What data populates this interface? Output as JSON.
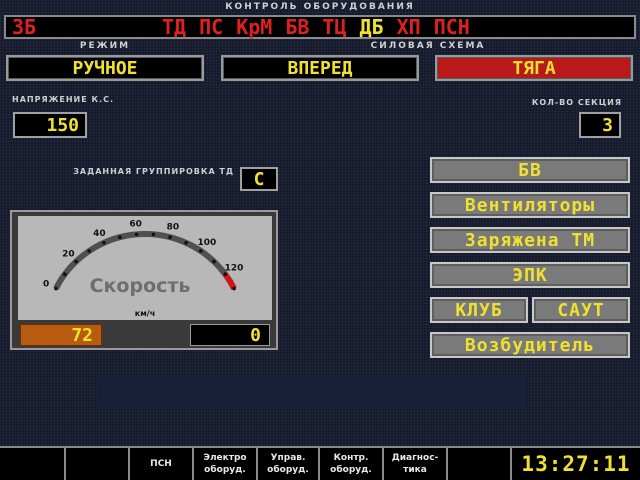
{
  "header": {
    "title": "КОНТРОЛЬ ОБОРУДОВАНИЯ",
    "code": "3Б",
    "indicators": [
      {
        "label": "ТД",
        "color": "#e02020"
      },
      {
        "label": "ПС",
        "color": "#e02020"
      },
      {
        "label": "КрМ",
        "color": "#e02020"
      },
      {
        "label": "БВ",
        "color": "#e02020"
      },
      {
        "label": "ТЦ",
        "color": "#e02020"
      },
      {
        "label": "ДБ",
        "color": "#f0e030"
      },
      {
        "label": "ХП",
        "color": "#e02020"
      },
      {
        "label": "ПСН",
        "color": "#e02020"
      }
    ]
  },
  "mode": {
    "label": "РЕЖИМ",
    "value": "РУЧНОЕ"
  },
  "power_scheme": {
    "label": "СИЛОВАЯ СХЕМА",
    "direction": "ВПЕРЕД",
    "state": "ТЯГА",
    "state_color": "#b81a1a"
  },
  "voltage": {
    "label": "НАПРЯЖЕНИЕ К.С.",
    "value": "150"
  },
  "sections": {
    "label": "КОЛ-ВО СЕКЦИЯ",
    "value": "3"
  },
  "grouping": {
    "label": "ЗАДАННАЯ ГРУППИРОВКА ТД",
    "value": "С"
  },
  "side_buttons": {
    "bv": "БВ",
    "fans": "Вентиляторы",
    "charged": "Заряжена ТМ",
    "epk": "ЭПК",
    "klub": "КЛУБ",
    "saut": "САУТ",
    "exciter": "Возбудитель"
  },
  "speedometer": {
    "title": "Скорость",
    "unit": "км/ч",
    "scale_min": 0,
    "scale_max": 130,
    "red_zone_from": 120,
    "tick_labels": [
      "0",
      "20",
      "40",
      "60",
      "80",
      "100",
      "120"
    ],
    "current_speed": "72",
    "target_speed": "0",
    "speed_box_color": "#b85a10"
  },
  "footer": {
    "keys": [
      {
        "line1": "",
        "line2": ""
      },
      {
        "line1": "",
        "line2": ""
      },
      {
        "line1": "ПСН",
        "line2": ""
      },
      {
        "line1": "Электро",
        "line2": "оборуд."
      },
      {
        "line1": "Управ.",
        "line2": "оборуд."
      },
      {
        "line1": "Контр.",
        "line2": "оборуд."
      },
      {
        "line1": "Диагнос-",
        "line2": "тика"
      },
      {
        "line1": "",
        "line2": ""
      }
    ],
    "clock": "13:27:11"
  },
  "colors": {
    "accent_yellow": "#f0e030",
    "alert_red": "#e02020"
  }
}
